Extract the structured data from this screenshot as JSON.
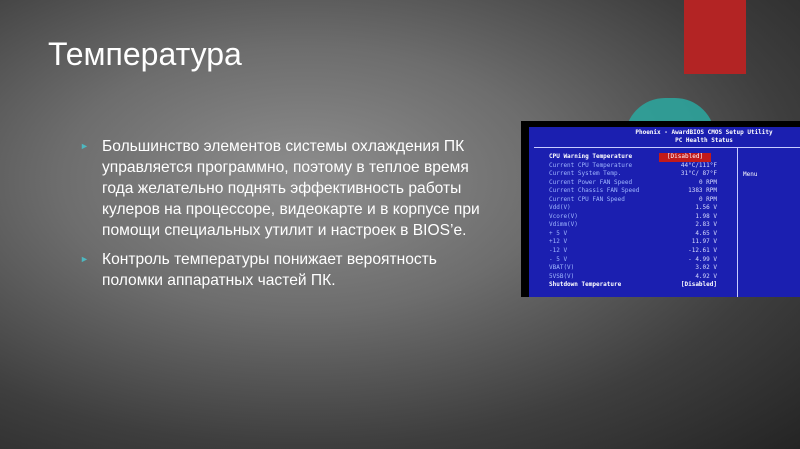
{
  "slide": {
    "title": "Температура",
    "bullets": [
      "Большинство элементов системы охлаждения ПК управляется программно, поэтому в теплое время года желательно поднять эффективность работы кулеров на процессоре, видеокарте и в корпусе при помощи специальных утилит и настроек в BIOS’е.",
      "Контроль температуры понижает вероятность поломки аппаратных частей ПК."
    ],
    "bullet_marker": "►"
  },
  "bios": {
    "header_line1": "Phoenix - AwardBIOS CMOS Setup Utility",
    "header_line2": "PC Health Status",
    "menu_label": "Menu",
    "rows": [
      {
        "label": "CPU Warning Temperature",
        "value": "[Disabled]"
      },
      {
        "label": "Current CPU Temperature",
        "value": "44°C/111°F"
      },
      {
        "label": "Current System Temp.",
        "value": "31°C/ 87°F"
      },
      {
        "label": "Current Power FAN Speed",
        "value": "0 RPM"
      },
      {
        "label": "Current Chassis FAN Speed",
        "value": "1383 RPM"
      },
      {
        "label": "Current CPU FAN Speed",
        "value": "0 RPM"
      },
      {
        "label": "Vdd(V)",
        "value": "1.56 V"
      },
      {
        "label": "Vcore(V)",
        "value": "1.98 V"
      },
      {
        "label": "Vdimm(V)",
        "value": "2.83 V"
      },
      {
        "label": "+ 5 V",
        "value": "4.65 V"
      },
      {
        "label": "+12 V",
        "value": "11.97 V"
      },
      {
        "label": "-12 V",
        "value": "-12.61 V"
      },
      {
        "label": "- 5 V",
        "value": "- 4.99 V"
      },
      {
        "label": "VBAT(V)",
        "value": "3.02 V"
      },
      {
        "label": "5VSB(V)",
        "value": "4.92 V"
      },
      {
        "label": "Shutdown Temperature",
        "value": "[Disabled]"
      }
    ]
  },
  "colors": {
    "accent_red": "#b32424",
    "accent_teal": "#2aa8a0",
    "bios_blue": "#1b1fb0"
  }
}
